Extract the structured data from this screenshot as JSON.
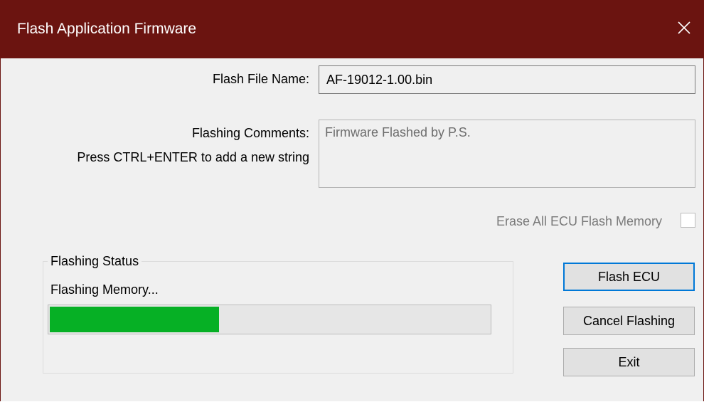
{
  "window": {
    "title": "Flash Application Firmware",
    "close_glyph": "✕",
    "titlebar_color": "#6b1410"
  },
  "form": {
    "file_name_label": "Flash File Name:",
    "file_name_value": "AF-19012-1.00.bin",
    "comments_label": "Flashing Comments:",
    "comments_hint": "Press CTRL+ENTER to add a new string",
    "comments_value": "Firmware Flashed by P.S.",
    "erase_label": "Erase All ECU Flash Memory",
    "erase_checked": false
  },
  "status": {
    "group_title": "Flashing Status",
    "message": "Flashing Memory...",
    "progress_fraction": 0.385,
    "progress_color": "#06b025"
  },
  "buttons": {
    "flash": "Flash ECU",
    "cancel": "Cancel Flashing",
    "exit": "Exit"
  },
  "icons": {
    "close": "close-icon"
  }
}
